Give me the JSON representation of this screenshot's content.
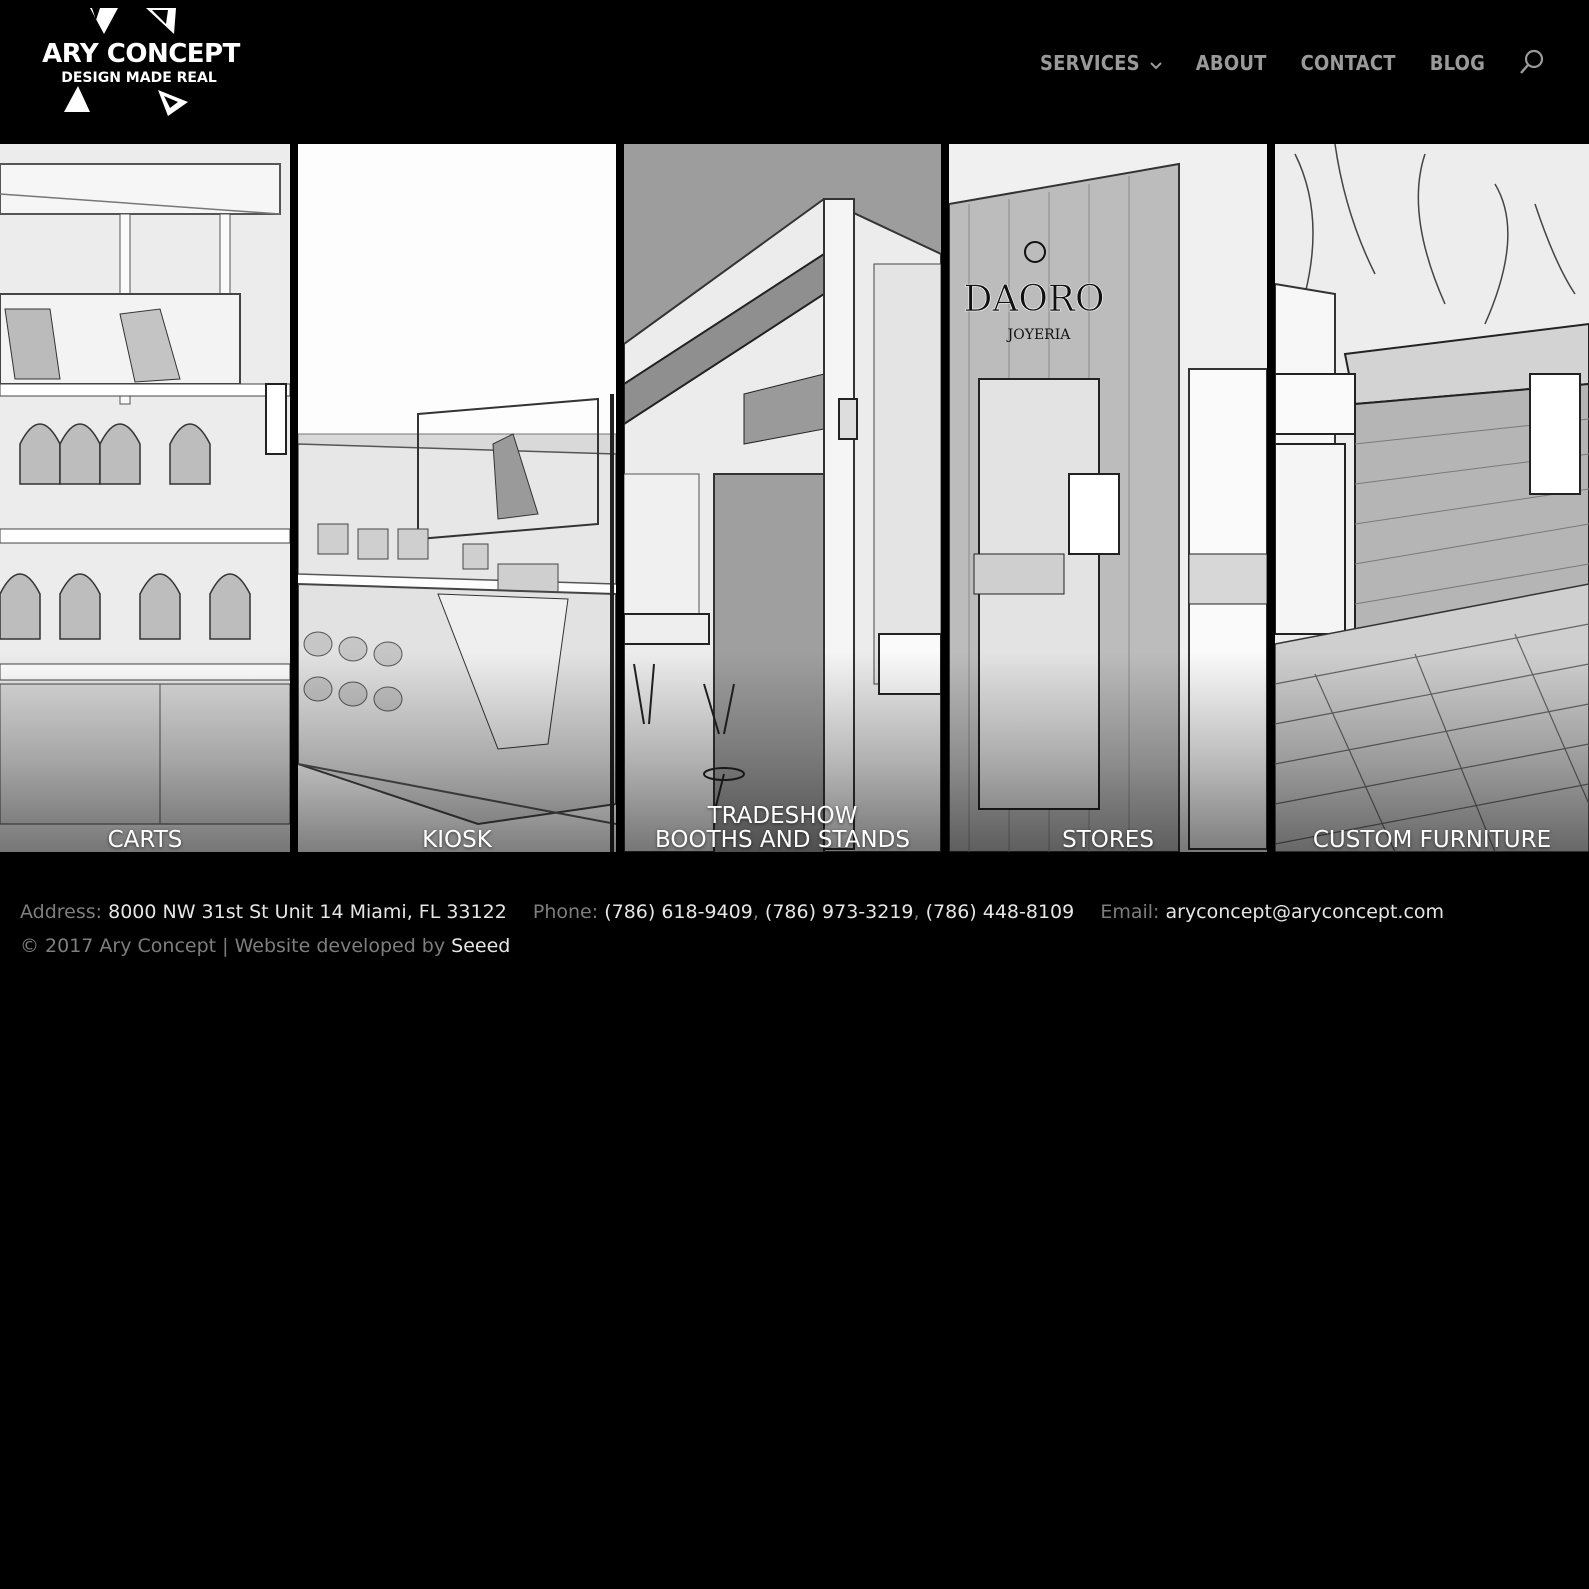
{
  "brand": {
    "title": "ARY CONCEPT",
    "tagline": "DESIGN MADE REAL"
  },
  "nav": {
    "items": [
      {
        "label": "SERVICES",
        "has_dropdown": true
      },
      {
        "label": "ABOUT"
      },
      {
        "label": "CONTACT"
      },
      {
        "label": "BLOG"
      }
    ],
    "search_icon": "search-icon"
  },
  "panels": [
    {
      "label_line1": "CARTS",
      "label_line2": ""
    },
    {
      "label_line1": "KIOSK",
      "label_line2": ""
    },
    {
      "label_line1": "TRADESHOW",
      "label_line2": "BOOTHS AND STANDS"
    },
    {
      "label_line1": "STORES",
      "label_line2": ""
    },
    {
      "label_line1": "CUSTOM FURNITURE",
      "label_line2": ""
    }
  ],
  "store_sign": {
    "name": "DAORO",
    "sub": "JOYERIA"
  },
  "footer": {
    "address_label": "Address:",
    "address": "8000 NW 31st St Unit 14 Miami, FL 33122",
    "phone_label": "Phone:",
    "phone1": "(786) 618-9409",
    "phone2": "(786) 973-3219",
    "phone3": "(786) 448-8109",
    "email_label": "Email:",
    "email": "aryconcept@aryconcept.com",
    "copyright": "© 2017 Ary Concept | Website developed by",
    "developer": "Seeed"
  },
  "colors": {
    "background": "#000000",
    "nav_text": "#9a9a9a",
    "footer_label": "#7e7e7e",
    "footer_value": "#e6e6e6"
  }
}
